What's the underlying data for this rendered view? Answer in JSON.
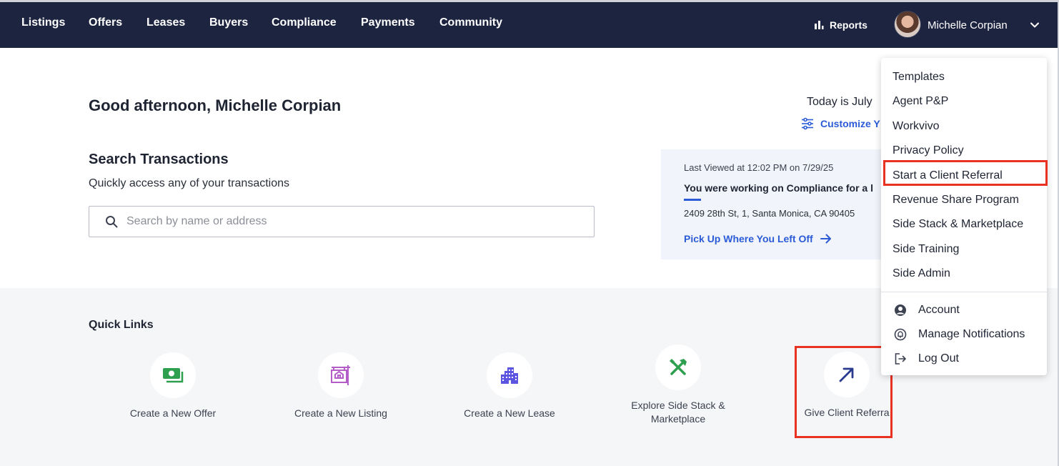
{
  "nav": {
    "items": [
      {
        "label": "Listings"
      },
      {
        "label": "Offers"
      },
      {
        "label": "Leases"
      },
      {
        "label": "Buyers"
      },
      {
        "label": "Compliance"
      },
      {
        "label": "Payments"
      },
      {
        "label": "Community"
      }
    ],
    "reports_label": "Reports",
    "user_name": "Michelle Corpian"
  },
  "main": {
    "greeting": "Good afternoon, Michelle Corpian",
    "today_text": "Today is July",
    "customize_label": "Customize Y",
    "search": {
      "title": "Search Transactions",
      "subtitle": "Quickly access any of your transactions",
      "placeholder": "Search by name or address",
      "value": ""
    }
  },
  "last_viewed": {
    "time_text": "Last Viewed at 12:02 PM on 7/29/25",
    "working_text": "You were working on Compliance for a l",
    "address": "2409 28th St, 1, Santa Monica, CA 90405",
    "link_label": "Pick Up Where You Left Off"
  },
  "quick_links": {
    "title": "Quick Links",
    "items": [
      {
        "label": "Create a New Offer",
        "icon": "money-icon",
        "color": "#2e9e4f"
      },
      {
        "label": "Create a New Listing",
        "icon": "listing-sign-icon",
        "color": "#b45cc8"
      },
      {
        "label": "Create a New Lease",
        "icon": "building-icon",
        "color": "#5b55e0"
      },
      {
        "label": "Explore Side Stack &",
        "label2": "Marketplace",
        "icon": "tools-icon",
        "color": "#2e9e4f"
      },
      {
        "label": "Give Client Referra",
        "icon": "arrow-up-right-icon",
        "color": "#2a3a8f"
      }
    ]
  },
  "dropdown": {
    "items": [
      {
        "label": "Templates"
      },
      {
        "label": "Agent P&P"
      },
      {
        "label": "Workvivo"
      },
      {
        "label": "Privacy Policy"
      },
      {
        "label": "Start a Client Referral"
      },
      {
        "label": "Revenue Share Program"
      },
      {
        "label": "Side Stack & Marketplace"
      },
      {
        "label": "Side Training"
      },
      {
        "label": "Side Admin"
      }
    ],
    "account_items": [
      {
        "label": "Account",
        "icon": "user-circle-icon"
      },
      {
        "label": "Manage Notifications",
        "icon": "bell-icon"
      },
      {
        "label": "Log Out",
        "icon": "logout-icon"
      }
    ]
  },
  "colors": {
    "nav_bg": "#1d2440",
    "accent_blue": "#2b5bd7",
    "highlight_red": "#ea3223"
  }
}
